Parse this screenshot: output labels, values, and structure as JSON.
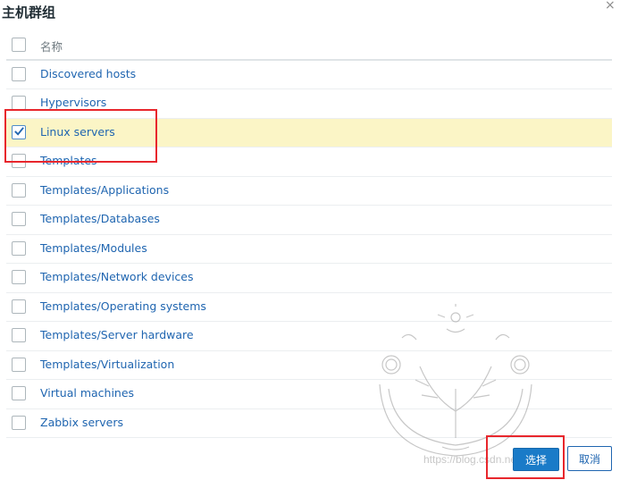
{
  "dialog": {
    "title": "主机群组",
    "close_glyph": "×"
  },
  "table": {
    "header_label": "名称",
    "rows": [
      {
        "label": "Discovered hosts",
        "checked": false
      },
      {
        "label": "Hypervisors",
        "checked": false
      },
      {
        "label": "Linux servers",
        "checked": true
      },
      {
        "label": "Templates",
        "checked": false
      },
      {
        "label": "Templates/Applications",
        "checked": false
      },
      {
        "label": "Templates/Databases",
        "checked": false
      },
      {
        "label": "Templates/Modules",
        "checked": false
      },
      {
        "label": "Templates/Network devices",
        "checked": false
      },
      {
        "label": "Templates/Operating systems",
        "checked": false
      },
      {
        "label": "Templates/Server hardware",
        "checked": false
      },
      {
        "label": "Templates/Virtualization",
        "checked": false
      },
      {
        "label": "Virtual machines",
        "checked": false
      },
      {
        "label": "Zabbix servers",
        "checked": false
      }
    ]
  },
  "buttons": {
    "select_label": "选择",
    "cancel_label": "取消"
  },
  "watermark": {
    "url": "https://blog.csdn.net/Myb"
  },
  "colors": {
    "link": "#1f65b0",
    "selected_row": "#fbf5c6",
    "primary_button": "#1a7bc8",
    "annotation_red": "#e8262c"
  },
  "icons": {
    "close": "close-icon",
    "check": "check-icon"
  }
}
